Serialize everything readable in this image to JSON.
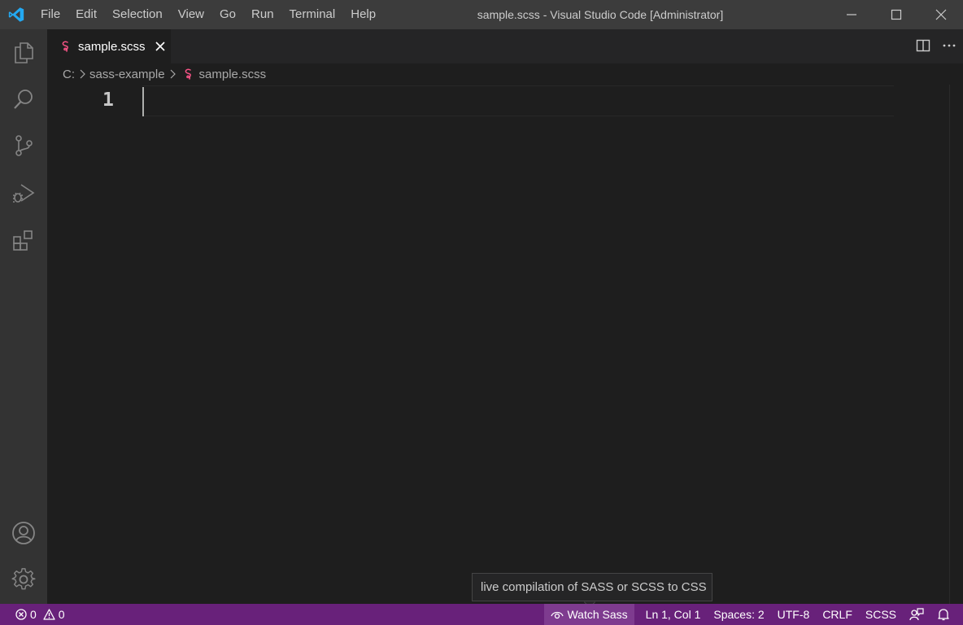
{
  "titlebar": {
    "menu": [
      "File",
      "Edit",
      "Selection",
      "View",
      "Go",
      "Run",
      "Terminal",
      "Help"
    ],
    "window_title": "sample.scss - Visual Studio Code [Administrator]"
  },
  "activitybar": {
    "icons": [
      "explorer-icon",
      "search-icon",
      "source-control-icon",
      "run-debug-icon",
      "extensions-icon",
      "account-icon",
      "manage-gear-icon"
    ]
  },
  "tab": {
    "label": "sample.scss",
    "icon": "sass-file-icon"
  },
  "breadcrumb": {
    "items": [
      "C:",
      "sass-example",
      "sample.scss"
    ]
  },
  "editor": {
    "line_numbers": [
      "1"
    ],
    "content": ""
  },
  "tooltip": {
    "text": "live compilation of SASS or SCSS to CSS"
  },
  "statusbar": {
    "errors": "0",
    "warnings": "0",
    "watch_sass": "Watch Sass",
    "position": "Ln 1, Col 1",
    "spaces": "Spaces: 2",
    "encoding": "UTF-8",
    "eol": "CRLF",
    "language": "SCSS"
  },
  "colors": {
    "statusbar_bg": "#68217a",
    "sass_pink": "#f55385",
    "vscode_blue": "#23a9f2"
  }
}
